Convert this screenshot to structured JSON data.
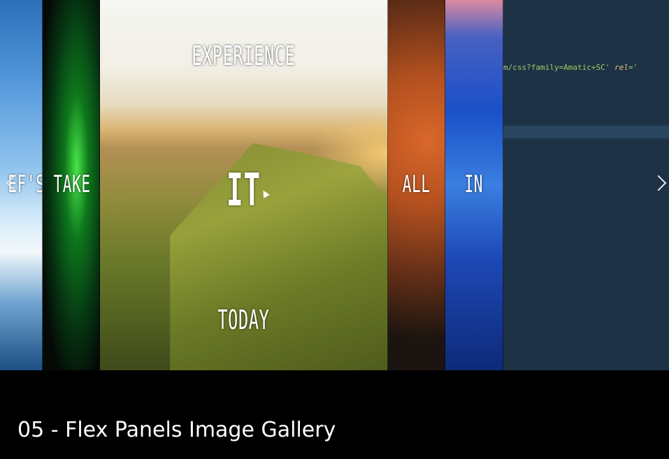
{
  "gallery": {
    "panels": [
      {
        "top": "",
        "mid": "EF'S",
        "bottom": ""
      },
      {
        "top": "",
        "mid": "TAKE",
        "bottom": ""
      },
      {
        "top": "EXPERIENCE",
        "mid": "IT",
        "bottom": "TODAY"
      },
      {
        "top": "",
        "mid": "ALL",
        "bottom": ""
      },
      {
        "top": "",
        "mid": "IN",
        "bottom": ""
      }
    ]
  },
  "editor": {
    "code_prefix": "m/css?family=Amatic+SC'",
    "code_attr": "rel",
    "code_suffix": "='"
  },
  "nav": {
    "prev_icon": "chevron-left-icon",
    "next_icon": "chevron-right-icon"
  },
  "caption": {
    "title": "05 - Flex Panels Image Gallery"
  }
}
